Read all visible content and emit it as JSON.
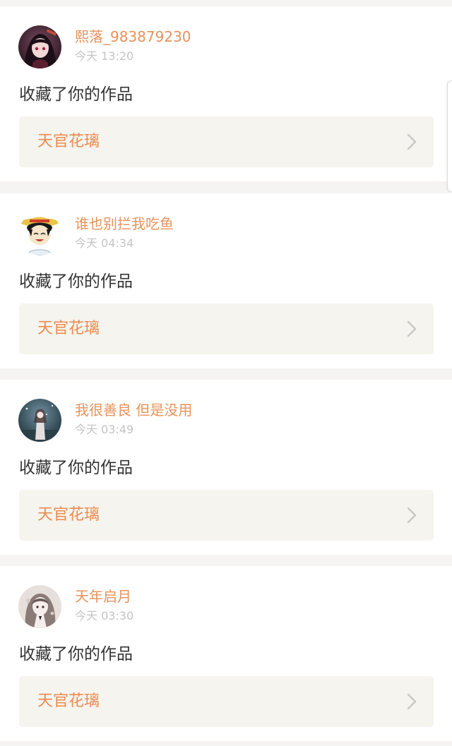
{
  "colors": {
    "page_background": "#f5f4f2",
    "card_background": "#ffffff",
    "username_color": "#e8925a",
    "timestamp_color": "#c4c4c4",
    "action_text_color": "#333333",
    "work_card_background": "#f5f4ee",
    "work_title_color": "#ec8a4f",
    "chevron_color": "#c8c8c8"
  },
  "notifications": [
    {
      "username": "熙落_983879230",
      "time": "今天 13:20",
      "action": "收藏了你的作品",
      "work_title": "天官花璃",
      "avatar_icon": "anime-girl-dark-avatar-icon"
    },
    {
      "username": "谁也别拦我吃鱼",
      "time": "今天 04:34",
      "action": "收藏了你的作品",
      "work_title": "天官花璃",
      "avatar_icon": "straw-hat-boy-avatar-icon"
    },
    {
      "username": "我很善良 但是没用",
      "time": "今天 03:49",
      "action": "收藏了你的作品",
      "work_title": "天官花璃",
      "avatar_icon": "girl-night-scene-avatar-icon"
    },
    {
      "username": "天年启月",
      "time": "今天 03:30",
      "action": "收藏了你的作品",
      "work_title": "天官花璃",
      "avatar_icon": "sketch-girl-avatar-icon"
    }
  ]
}
